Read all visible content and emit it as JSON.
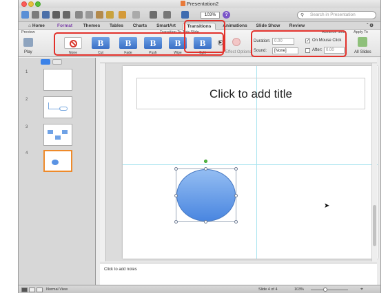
{
  "window": {
    "title": "Presentation2"
  },
  "toolbar": {
    "zoom": "103%",
    "help": "?",
    "search_placeholder": "Search in Presentation"
  },
  "tabs": [
    {
      "label": "Home"
    },
    {
      "label": "Format"
    },
    {
      "label": "Themes"
    },
    {
      "label": "Tables"
    },
    {
      "label": "Charts"
    },
    {
      "label": "SmartArt"
    },
    {
      "label": "Transitions"
    },
    {
      "label": "Animations"
    },
    {
      "label": "Slide Show"
    },
    {
      "label": "Review"
    }
  ],
  "ribbon": {
    "preview_group": "Preview",
    "play_label": "Play",
    "transition_group": "Transition To This Slide",
    "transitions": [
      {
        "label": "None",
        "glyph": ""
      },
      {
        "label": "Cut",
        "glyph": "B"
      },
      {
        "label": "Fade",
        "glyph": "B"
      },
      {
        "label": "Push",
        "glyph": "B"
      },
      {
        "label": "Wipe",
        "glyph": "B"
      },
      {
        "label": "Split",
        "glyph": "B"
      }
    ],
    "effect_options": "Effect Options",
    "duration_label": "Duration:",
    "duration_value": "0.00",
    "sound_label": "Sound:",
    "sound_value": "[None]",
    "advance_group": "Advance Slide",
    "on_mouse_click": "On Mouse Click",
    "after_label": "After:",
    "after_value": "0.00",
    "apply_to_group": "Apply To",
    "all_slides": "All Slides"
  },
  "slides_panel": {
    "numbers": [
      "1",
      "2",
      "3",
      "4"
    ]
  },
  "slide": {
    "title_placeholder": "Click to add title"
  },
  "notes": {
    "placeholder": "Click to add notes"
  },
  "status": {
    "view": "Normal View",
    "slide_counter": "Slide 4 of 4",
    "zoom": "103%"
  }
}
